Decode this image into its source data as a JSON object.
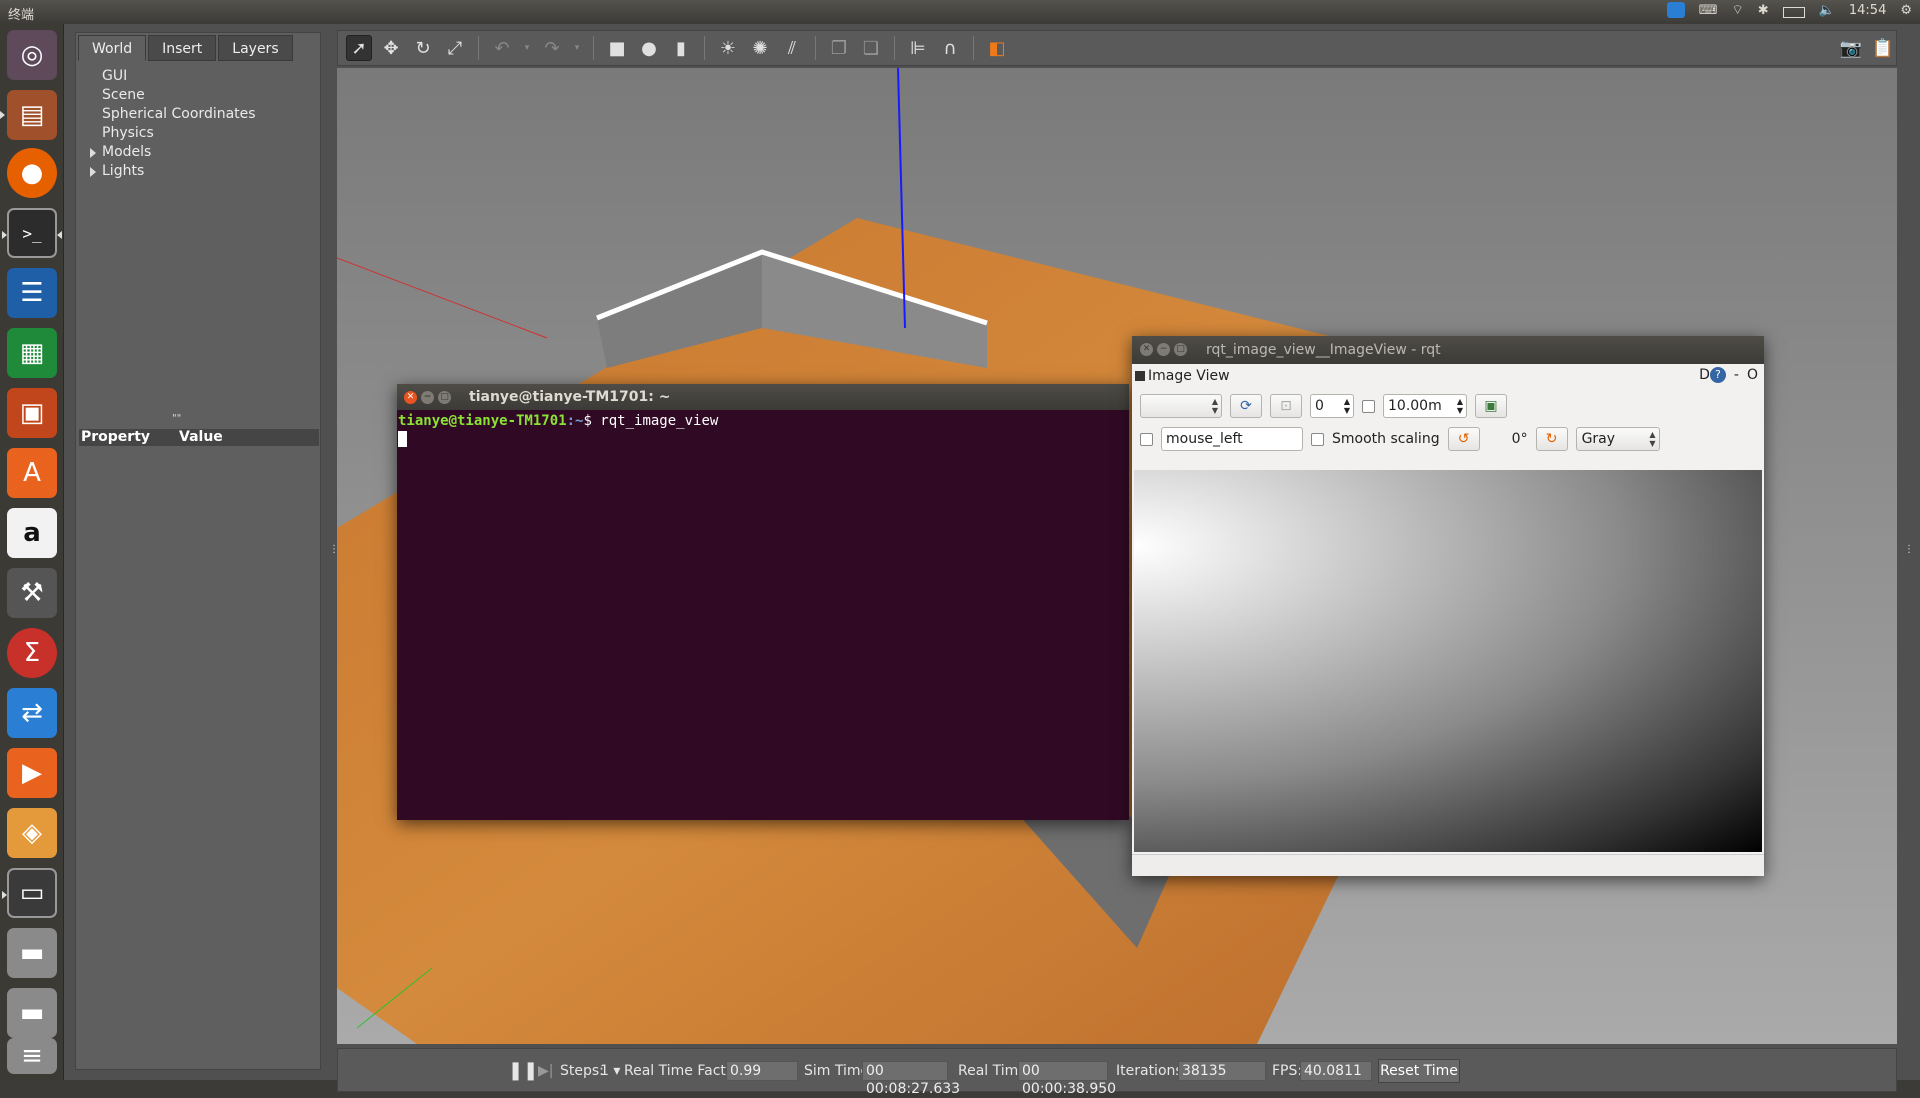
{
  "topbar": {
    "title": "终端",
    "clock": "14:54",
    "tray_icons": [
      "teamviewer-icon",
      "keyboard-icon",
      "wifi-icon",
      "bluetooth-icon",
      "battery-icon",
      "volume-icon",
      "settings-icon"
    ]
  },
  "launcher": {
    "items": [
      {
        "name": "ubuntu-dash",
        "icon": "ubuntu-logo-icon",
        "color": "#5e2750"
      },
      {
        "name": "files",
        "icon": "file-manager-icon",
        "color": "#a0502a"
      },
      {
        "name": "firefox",
        "icon": "firefox-icon",
        "color": "#e66000"
      },
      {
        "name": "terminal",
        "icon": "terminal-icon",
        "color": "#2c2c2c"
      },
      {
        "name": "libreoffice-writer",
        "icon": "writer-icon",
        "color": "#1f5fa8"
      },
      {
        "name": "libreoffice-calc",
        "icon": "calc-icon",
        "color": "#1f8a3a"
      },
      {
        "name": "libreoffice-impress",
        "icon": "impress-icon",
        "color": "#c2461b"
      },
      {
        "name": "software-center",
        "icon": "software-center-icon",
        "color": "#e9631e"
      },
      {
        "name": "amazon",
        "icon": "amazon-icon",
        "color": "#f2f2f2"
      },
      {
        "name": "system-settings",
        "icon": "settings-tools-icon",
        "color": "#555"
      },
      {
        "name": "app-red",
        "icon": "red-app-icon",
        "color": "#c8302a"
      },
      {
        "name": "teamviewer",
        "icon": "teamviewer-icon",
        "color": "#2a7fd4"
      },
      {
        "name": "vlc-app",
        "icon": "media-icon",
        "color": "#e9631e"
      },
      {
        "name": "sublime",
        "icon": "box-icon",
        "color": "#e49a3a"
      },
      {
        "name": "gazebo-window",
        "icon": "window-icon",
        "color": "#3a3a3a"
      },
      {
        "name": "drive-1",
        "icon": "drive-icon",
        "color": "#888"
      },
      {
        "name": "drive-2",
        "icon": "drive-icon",
        "color": "#888"
      },
      {
        "name": "trash",
        "icon": "stack-icon",
        "color": "#888"
      }
    ]
  },
  "gazebo": {
    "tabs": [
      "World",
      "Insert",
      "Layers"
    ],
    "tree": [
      {
        "label": "GUI",
        "expandable": false
      },
      {
        "label": "Scene",
        "expandable": false
      },
      {
        "label": "Spherical Coordinates",
        "expandable": false
      },
      {
        "label": "Physics",
        "expandable": false
      },
      {
        "label": "Models",
        "expandable": true
      },
      {
        "label": "Lights",
        "expandable": true
      }
    ],
    "property_header": {
      "property": "Property",
      "value": "Value"
    },
    "status": {
      "steps_label": "Steps:",
      "steps_value": "1",
      "rtf_label": "Real Time Factor:",
      "rtf_value": "0.99",
      "sim_label": "Sim Time:",
      "sim_value": "00 00:08:27.633",
      "real_label": "Real Time:",
      "real_value": "00 00:00:38.950",
      "iter_label": "Iterations:",
      "iter_value": "38135",
      "fps_label": "FPS:",
      "fps_value": "40.0811",
      "reset_label": "Reset Time"
    }
  },
  "terminal": {
    "title": "tianye@tianye-TM1701: ~",
    "prompt_user": "tianye@tianye-TM1701",
    "prompt_path": ":~",
    "prompt_symbol": "$ ",
    "command": "rqt_image_view"
  },
  "rqt": {
    "title": "rqt_image_view__ImageView - rqt",
    "header": "Image View",
    "header_right": "D",
    "header_minus": "-",
    "header_o": "O",
    "topic_value": "",
    "num_value": "0",
    "duration_value": "10.00m",
    "mouse_topic": "mouse_left",
    "smooth_label": "Smooth scaling",
    "rotation": "0°",
    "colormap": "Gray"
  }
}
